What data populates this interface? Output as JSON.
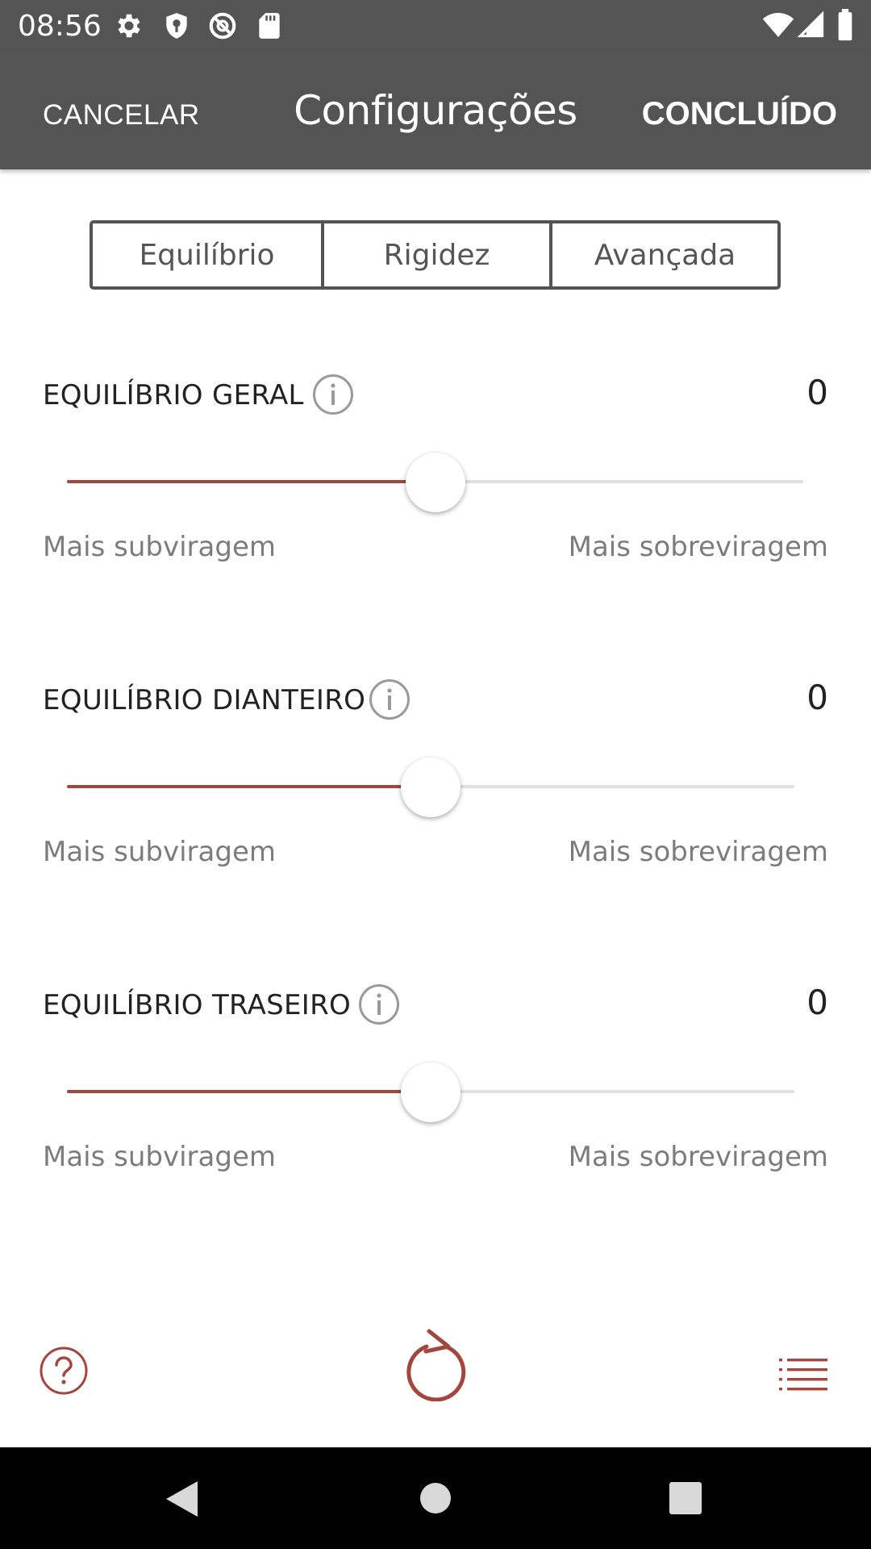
{
  "status_bar": {
    "time": "08:56"
  },
  "app_bar": {
    "cancel_label": "CANCELAR",
    "title": "Configurações",
    "done_label": "CONCLUÍDO"
  },
  "tabs": [
    {
      "label": "Equilíbrio",
      "active": true
    },
    {
      "label": "Rigidez",
      "active": false
    },
    {
      "label": "Avançada",
      "active": false
    }
  ],
  "settings": [
    {
      "label": "EQUILÍBRIO GERAL",
      "value": "0",
      "slider_position": 0.5,
      "min_label": "Mais subviragem",
      "max_label": "Mais sobreviragem"
    },
    {
      "label": "EQUILÍBRIO DIANTEIRO",
      "value": "0",
      "slider_position": 0.5,
      "min_label": "Mais subviragem",
      "max_label": "Mais sobreviragem"
    },
    {
      "label": "EQUILÍBRIO TRASEIRO",
      "value": "0",
      "slider_position": 0.5,
      "min_label": "Mais subviragem",
      "max_label": "Mais sobreviragem"
    }
  ],
  "toolbar": {
    "help_icon": "help-circle-icon",
    "reset_icon": "refresh-icon",
    "list_icon": "list-icon"
  },
  "colors": {
    "accent": "#a3463e",
    "bar": "#545454",
    "track": "#e0e0e0"
  }
}
